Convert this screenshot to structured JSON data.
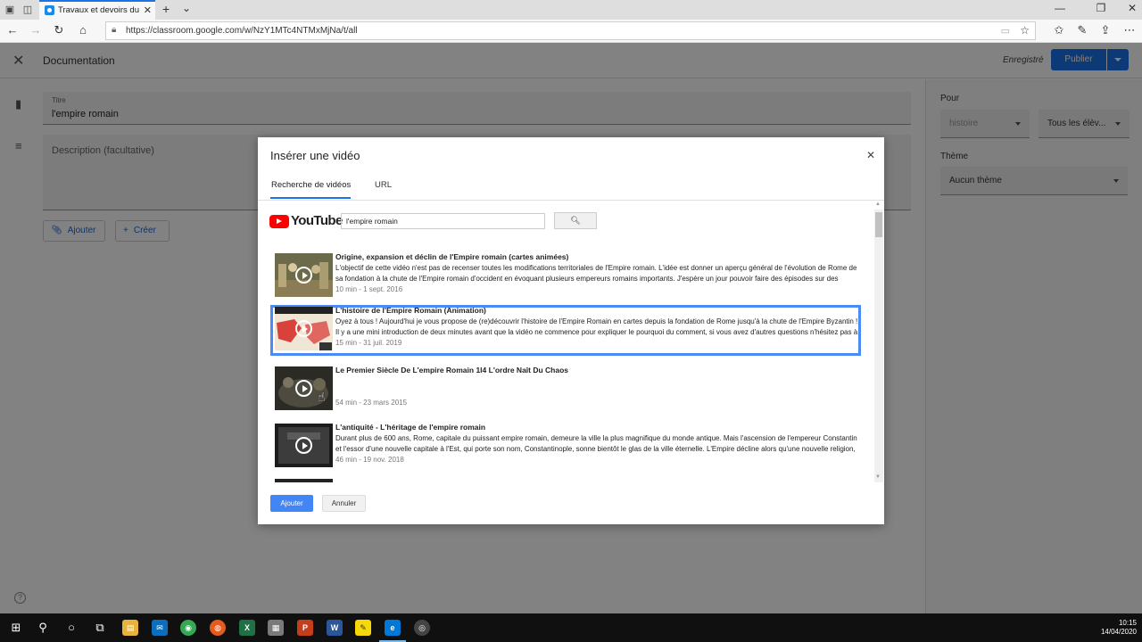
{
  "browser": {
    "tab_title": "Travaux et devoirs du cours",
    "url": "https://classroom.google.com/w/NzY1MTc4NTMxMjNa/t/all"
  },
  "page": {
    "header_title": "Documentation",
    "saved_label": "Enregistré",
    "publish_label": "Publier",
    "title_field_label": "Titre",
    "title_field_value": "l'empire romain",
    "description_placeholder": "Description (facultative)",
    "add_label": "Ajouter",
    "create_label": "Créer",
    "side": {
      "for_label": "Pour",
      "class_value": "histoire",
      "students_value": "Tous les élèv...",
      "theme_label": "Thème",
      "theme_value": "Aucun thème"
    }
  },
  "modal": {
    "title": "Insérer une vidéo",
    "tabs": [
      {
        "label": "Recherche de vidéos",
        "active": true
      },
      {
        "label": "URL",
        "active": false
      }
    ],
    "youtube_word": "YouTube",
    "search_value": "l'empire romain",
    "search_icon": "search-icon",
    "videos": [
      {
        "title": "Origine, expansion et déclin de l'Empire romain (cartes animées)",
        "description": "L'objectif de cette vidéo n'est pas de recenser toutes les modifications territoriales de l'Empire romain. L'idée est donner un aperçu général de l'évolution de Rome de sa fondation à la chute de l'Empire romain d'occident en évoquant plusieurs empereurs romains importants. J'espère un jour pouvoir faire des épisodes sur des",
        "meta": "10 min - 1 sept. 2016",
        "selected": false
      },
      {
        "title": "L'histoire de l'Empire Romain (Animation)",
        "description": "Oyez à tous ! Aujourd'hui je vous propose de (re)découvrir l'histoire de l'Empire Romain en cartes depuis la fondation de Rome jusqu'à la chute de l'Empire Byzantin ! Il y a une mini introduction de deux minutes avant que la vidéo ne commence pour expliquer le pourquoi du comment, si vous avez d'autres questions n'hésitez pas à",
        "meta": "15 min - 31 juil. 2019",
        "selected": true
      },
      {
        "title": "Le Premier Siècle De L'empire Romain 1l4 L'ordre Naît Du Chaos",
        "description": "",
        "meta": "54 min - 23 mars 2015",
        "selected": false
      },
      {
        "title": "L'antiquité - L'héritage de l'empire romain",
        "description": "Durant plus de 600 ans, Rome, capitale du puissant empire romain, demeure la ville la plus magnifique du monde antique. Mais l'ascension de l'empereur Constantin et l'essor d'une nouvelle capitale à l'Est, qui porte son nom, Constantinople, sonne bientôt le glas de la ville éternelle. L'Empire décline alors qu'une nouvelle religion, le",
        "meta": "46 min - 19 nov. 2018",
        "selected": false
      }
    ],
    "add_button": "Ajouter",
    "cancel_button": "Annuler"
  },
  "taskbar": {
    "time": "10:15",
    "date": "14/04/2020"
  },
  "colors": {
    "accent": "#1a73e8",
    "selection": "#4a8bf5",
    "youtube_red": "#ff0000"
  }
}
